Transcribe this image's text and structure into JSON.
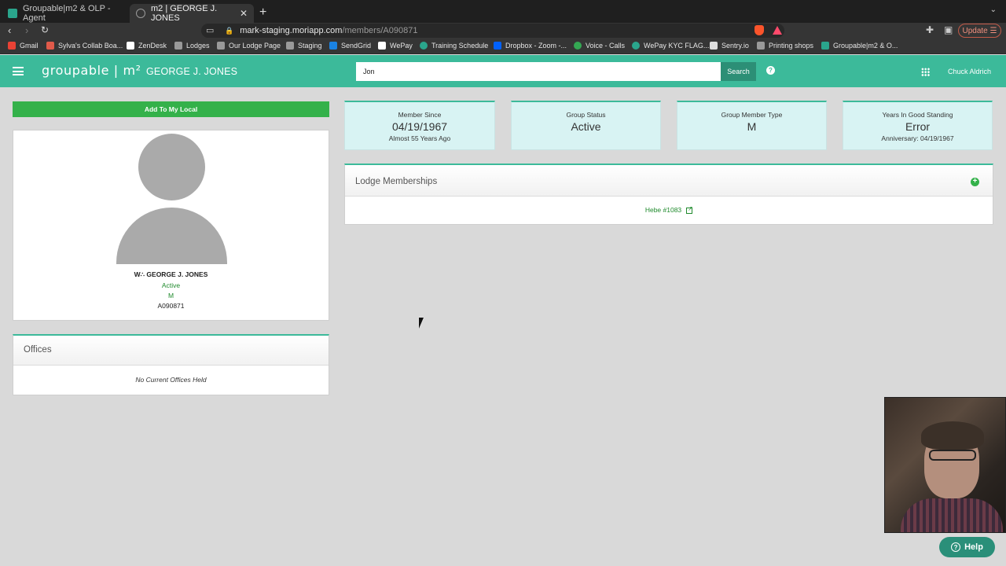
{
  "browser": {
    "tabs": [
      {
        "title": "Groupable|m2 & OLP - Agent"
      },
      {
        "title": "m2 | GEORGE J. JONES"
      }
    ],
    "url_host": "mark-staging.moriapp.com",
    "url_path": "/members/A090871",
    "update_label": "Update",
    "bookmarks": [
      "Gmail",
      "Sylva's Collab Boa...",
      "ZenDesk",
      "Lodges",
      "Our Lodge Page",
      "Staging",
      "SendGrid",
      "WePay",
      "Training Schedule",
      "Dropbox - Zoom -...",
      "Voice - Calls",
      "WePay KYC FLAG...",
      "Sentry.io",
      "Printing shops",
      "Groupable|m2 & O..."
    ]
  },
  "header": {
    "logo": "groupable | m²",
    "member_name": "GEORGE J. JONES",
    "search_value": "Jon",
    "search_label": "Search",
    "user_name": "Chuck Aldrich"
  },
  "profile": {
    "add_local_label": "Add To My Local",
    "name": "W∴ GEORGE J. JONES",
    "status": "Active",
    "type": "M",
    "member_id": "A090871"
  },
  "offices": {
    "title": "Offices",
    "empty_text": "No Current Offices Held"
  },
  "stats": [
    {
      "label": "Member Since",
      "value": "04/19/1967",
      "sub": "Almost 55 Years Ago"
    },
    {
      "label": "Group Status",
      "value": "Active",
      "sub": ""
    },
    {
      "label": "Group Member Type",
      "value": "M",
      "sub": ""
    },
    {
      "label": "Years In Good Standing",
      "value": "Error",
      "sub": "Anniversary: 04/19/1967"
    }
  ],
  "lodge_memberships": {
    "title": "Lodge Memberships",
    "items": [
      {
        "label": "Hebe #1083"
      }
    ]
  },
  "help_label": "Help",
  "colors": {
    "brand": "#3cba9a",
    "brand_dark": "#2c8f76",
    "success": "#34b14a",
    "status_text": "#1f8a2c",
    "stat_bg": "#d8f3f3"
  }
}
